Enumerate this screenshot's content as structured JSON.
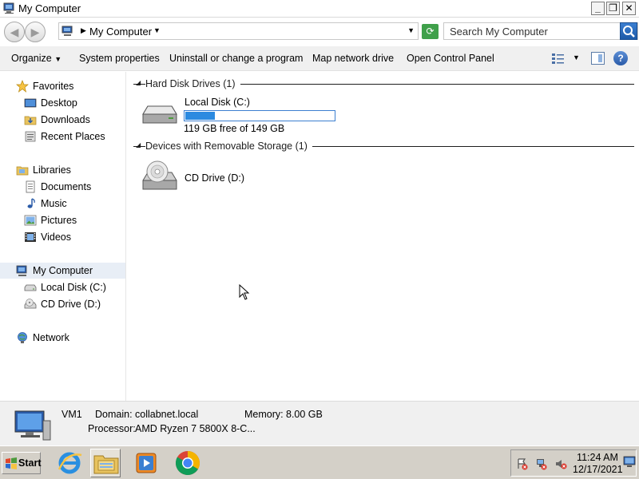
{
  "window": {
    "title": "My Computer",
    "minimize_glyph": "_",
    "maximize_glyph": "❐",
    "close_glyph": "✕"
  },
  "address_bar": {
    "path": "My Computer",
    "search_placeholder": "Search My Computer"
  },
  "toolbar": {
    "organize": "Organize",
    "system_properties": "System properties",
    "uninstall": "Uninstall or change a program",
    "map_drive": "Map network drive",
    "control_panel": "Open Control Panel"
  },
  "nav": {
    "favorites": "Favorites",
    "desktop": "Desktop",
    "downloads": "Downloads",
    "recent_places": "Recent Places",
    "libraries": "Libraries",
    "documents": "Documents",
    "music": "Music",
    "pictures": "Pictures",
    "videos": "Videos",
    "my_computer": "My Computer",
    "local_disk": "Local Disk (C:)",
    "cd_drive": "CD Drive (D:)",
    "network": "Network"
  },
  "content": {
    "hdd_group": "Hard Disk Drives (1)",
    "removable_group": "Devices with Removable Storage (1)",
    "local_disk": {
      "name": "Local Disk (C:)",
      "free_text": "119 GB free of 149 GB",
      "used_fraction": 0.2
    },
    "cd_drive": {
      "name": "CD Drive (D:)"
    }
  },
  "details": {
    "computer_name": "VM1",
    "domain_label": "Domain:",
    "domain_value": "collabnet.local",
    "memory_label": "Memory:",
    "memory_value": "8.00 GB",
    "processor_label": "Processor:",
    "processor_value": "AMD Ryzen 7 5800X 8-C..."
  },
  "taskbar": {
    "start_label": "Start",
    "apps": [
      "internet-explorer",
      "windows-explorer",
      "media-player",
      "chrome"
    ],
    "time": "11:24 AM",
    "date": "12/17/2021"
  },
  "colors": {
    "accent": "#2b8ae0",
    "toolbar_bg": "#f0f0f0",
    "taskbar_bg": "#d4d0c8"
  }
}
